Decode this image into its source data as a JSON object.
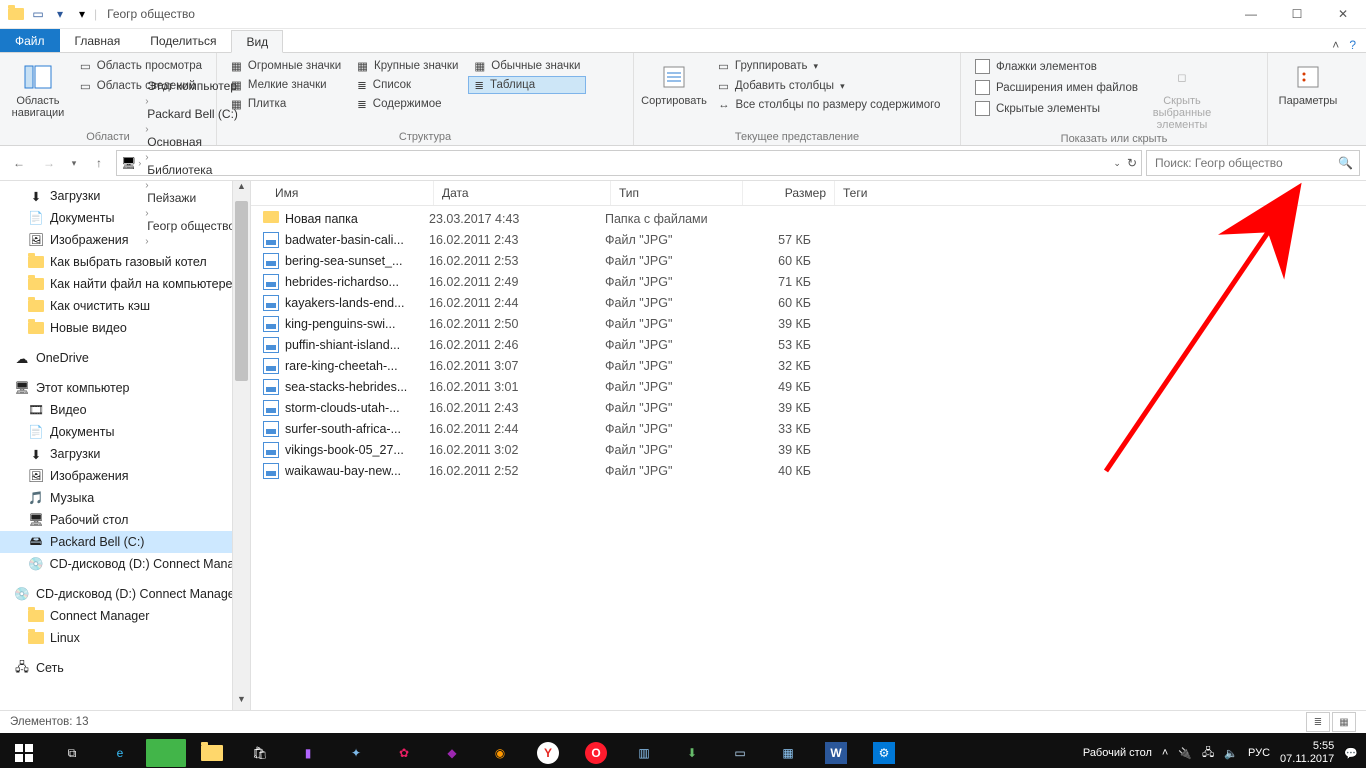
{
  "title": "Геогр общество",
  "tabs": {
    "file": "Файл",
    "home": "Главная",
    "share": "Поделиться",
    "view": "Вид"
  },
  "ribbon": {
    "nav_panel": "Область навигации",
    "panes_group": "Области",
    "pane_preview": "Область просмотра",
    "pane_details": "Область сведений",
    "layout_group": "Структура",
    "icons_xl": "Огромные значки",
    "icons_l": "Крупные значки",
    "icons_m": "Обычные значки",
    "icons_s": "Мелкие значки",
    "list": "Список",
    "details": "Таблица",
    "tiles": "Плитка",
    "content": "Содержимое",
    "sort": "Сортировать",
    "current_view_group": "Текущее представление",
    "group_by": "Группировать",
    "add_cols": "Добавить столбцы",
    "size_cols": "Все столбцы по размеру содержимого",
    "show_hide_group": "Показать или скрыть",
    "chk_boxes": "Флажки элементов",
    "chk_ext": "Расширения имен файлов",
    "chk_hidden": "Скрытые элементы",
    "hide_sel": "Скрыть выбранные элементы",
    "options": "Параметры"
  },
  "breadcrumb": [
    "Этот компьютер",
    "Packard Bell (C:)",
    "Основная",
    "Библиотека",
    "Пейзажи",
    "Геогр общество"
  ],
  "search_placeholder": "Поиск: Геогр общество",
  "columns": {
    "name": "Имя",
    "date": "Дата",
    "type": "Тип",
    "size": "Размер",
    "tags": "Теги"
  },
  "files": [
    {
      "icon": "folder",
      "name": "Новая папка",
      "date": "23.03.2017 4:43",
      "type": "Папка с файлами",
      "size": ""
    },
    {
      "icon": "img",
      "name": "badwater-basin-cali...",
      "date": "16.02.2011 2:43",
      "type": "Файл \"JPG\"",
      "size": "57 КБ"
    },
    {
      "icon": "img",
      "name": "bering-sea-sunset_...",
      "date": "16.02.2011 2:53",
      "type": "Файл \"JPG\"",
      "size": "60 КБ"
    },
    {
      "icon": "img",
      "name": "hebrides-richardso...",
      "date": "16.02.2011 2:49",
      "type": "Файл \"JPG\"",
      "size": "71 КБ"
    },
    {
      "icon": "img",
      "name": "kayakers-lands-end...",
      "date": "16.02.2011 2:44",
      "type": "Файл \"JPG\"",
      "size": "60 КБ"
    },
    {
      "icon": "img",
      "name": "king-penguins-swi...",
      "date": "16.02.2011 2:50",
      "type": "Файл \"JPG\"",
      "size": "39 КБ"
    },
    {
      "icon": "img",
      "name": "puffin-shiant-island...",
      "date": "16.02.2011 2:46",
      "type": "Файл \"JPG\"",
      "size": "53 КБ"
    },
    {
      "icon": "img",
      "name": "rare-king-cheetah-...",
      "date": "16.02.2011 3:07",
      "type": "Файл \"JPG\"",
      "size": "32 КБ"
    },
    {
      "icon": "img",
      "name": "sea-stacks-hebrides...",
      "date": "16.02.2011 3:01",
      "type": "Файл \"JPG\"",
      "size": "49 КБ"
    },
    {
      "icon": "img",
      "name": "storm-clouds-utah-...",
      "date": "16.02.2011 2:43",
      "type": "Файл \"JPG\"",
      "size": "39 КБ"
    },
    {
      "icon": "img",
      "name": "surfer-south-africa-...",
      "date": "16.02.2011 2:44",
      "type": "Файл \"JPG\"",
      "size": "33 КБ"
    },
    {
      "icon": "img",
      "name": "vikings-book-05_27...",
      "date": "16.02.2011 3:02",
      "type": "Файл \"JPG\"",
      "size": "39 КБ"
    },
    {
      "icon": "img",
      "name": "waikawau-bay-new...",
      "date": "16.02.2011 2:52",
      "type": "Файл \"JPG\"",
      "size": "40 КБ"
    }
  ],
  "tree": [
    {
      "label": "Загрузки",
      "icon": "dl",
      "lvl": 2
    },
    {
      "label": "Документы",
      "icon": "doc",
      "lvl": 2
    },
    {
      "label": "Изображения",
      "icon": "img",
      "lvl": 2
    },
    {
      "label": "Как выбрать газовый котел",
      "icon": "folder",
      "lvl": 2
    },
    {
      "label": "Как найти файл на компьютере",
      "icon": "folder",
      "lvl": 2
    },
    {
      "label": "Как очистить кэш",
      "icon": "folder",
      "lvl": 2
    },
    {
      "label": "Новые видео",
      "icon": "folder",
      "lvl": 2
    },
    {
      "label": "OneDrive",
      "icon": "od",
      "lvl": 1,
      "gap": true
    },
    {
      "label": "Этот компьютер",
      "icon": "pc",
      "lvl": 1,
      "gap": true
    },
    {
      "label": "Видео",
      "icon": "vid",
      "lvl": 2
    },
    {
      "label": "Документы",
      "icon": "doc",
      "lvl": 2
    },
    {
      "label": "Загрузки",
      "icon": "dl",
      "lvl": 2
    },
    {
      "label": "Изображения",
      "icon": "img",
      "lvl": 2
    },
    {
      "label": "Музыка",
      "icon": "mus",
      "lvl": 2
    },
    {
      "label": "Рабочий стол",
      "icon": "desk",
      "lvl": 2
    },
    {
      "label": "Packard Bell (C:)",
      "icon": "hdd",
      "lvl": 2,
      "sel": true
    },
    {
      "label": "CD-дисковод (D:) Connect Manager",
      "icon": "cd",
      "lvl": 2
    },
    {
      "label": "CD-дисковод (D:) Connect Manager",
      "icon": "cd2",
      "lvl": 1,
      "gap": true
    },
    {
      "label": "Connect Manager",
      "icon": "folder",
      "lvl": 2
    },
    {
      "label": "Linux",
      "icon": "folder",
      "lvl": 2
    },
    {
      "label": "Сеть",
      "icon": "net",
      "lvl": 1,
      "gap": true
    }
  ],
  "status": "Элементов: 13",
  "tray": {
    "desk": "Рабочий стол",
    "lang": "РУС",
    "time": "5:55",
    "date": "07.11.2017"
  }
}
